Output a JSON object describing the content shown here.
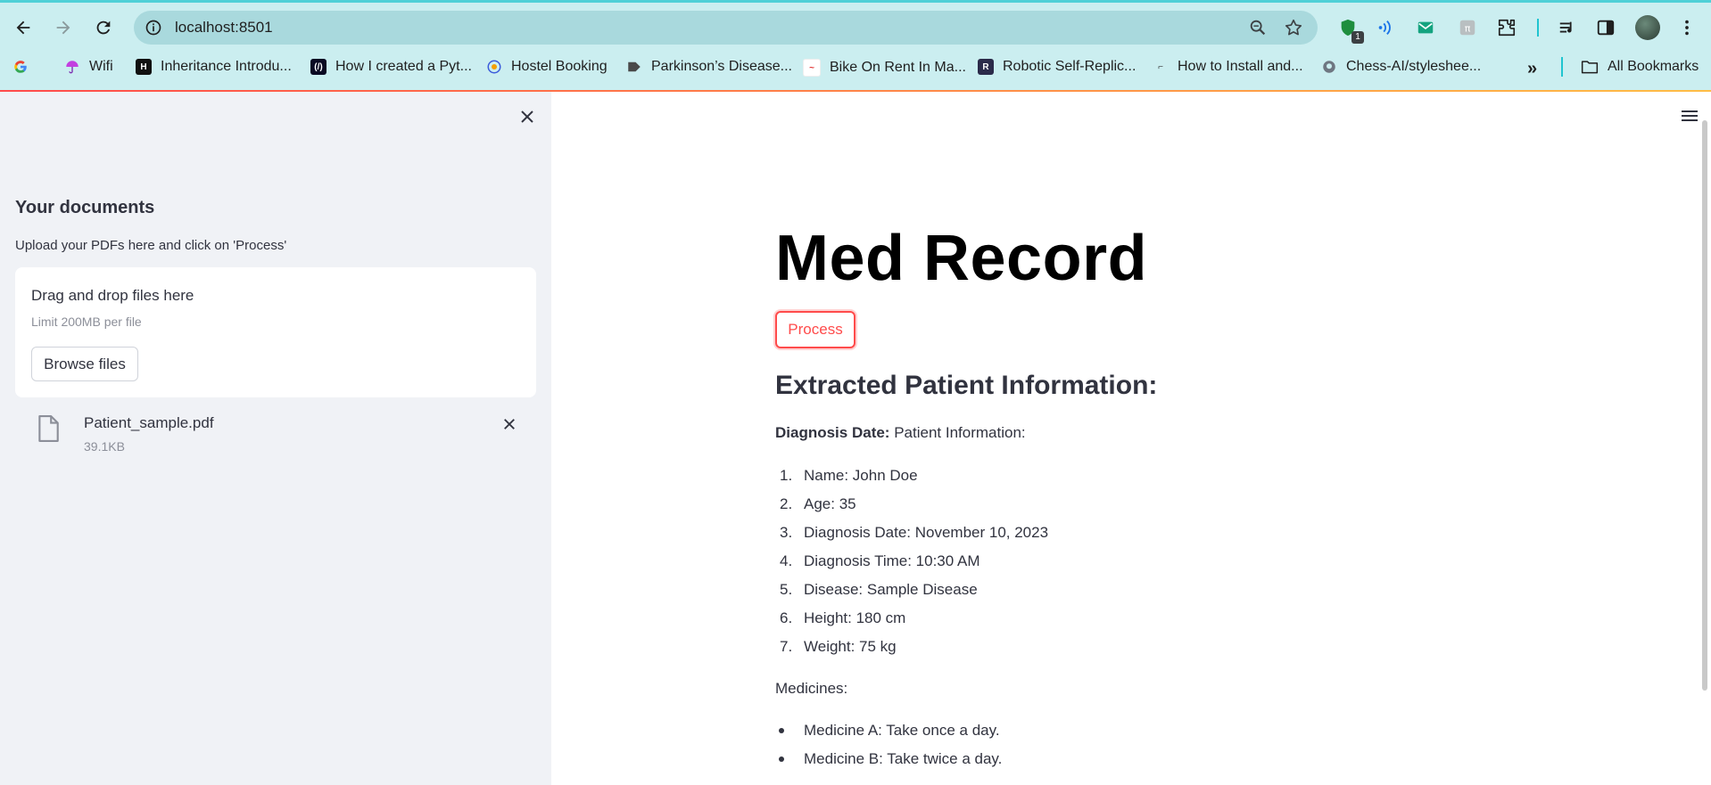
{
  "browser": {
    "url": "localhost:8501",
    "extension_badge": "1",
    "bookmarks": [
      {
        "label": "Wifi",
        "icon": "umbrella-icon"
      },
      {
        "label": "Inheritance Introdu...",
        "icon": "hashnode-icon"
      },
      {
        "label": "How I created a Pyt...",
        "icon": "freecodecamp-icon"
      },
      {
        "label": "Hostel Booking",
        "icon": "hostel-icon"
      },
      {
        "label": "Parkinson’s Disease...",
        "icon": "tag-icon"
      },
      {
        "label": "Bike On Rent In Ma...",
        "icon": "bike-rent-icon"
      },
      {
        "label": "Robotic Self-Replic...",
        "icon": "r-logo-icon"
      },
      {
        "label": "How to Install and...",
        "icon": "tool-icon"
      },
      {
        "label": "Chess-AI/styleshee...",
        "icon": "github-icon"
      }
    ],
    "all_bookmarks": "All Bookmarks"
  },
  "sidebar": {
    "title": "Your documents",
    "caption": "Upload your PDFs here and click on 'Process'",
    "dropzone": {
      "title": "Drag and drop files here",
      "limit": "Limit 200MB per file",
      "browse_label": "Browse files"
    },
    "file": {
      "name": "Patient_sample.pdf",
      "size": "39.1KB"
    }
  },
  "main": {
    "title": "Med Record",
    "process_label": "Process",
    "subheading": "Extracted Patient Information:",
    "diagnosis_label": "Diagnosis Date:",
    "diagnosis_value": "Patient Information:",
    "info_items": [
      {
        "num": "1.",
        "text": "Name: John Doe"
      },
      {
        "num": "2.",
        "text": "Age: 35"
      },
      {
        "num": "3.",
        "text": "Diagnosis Date: November 10, 2023"
      },
      {
        "num": "4.",
        "text": "Diagnosis Time: 10:30 AM"
      },
      {
        "num": "5.",
        "text": "Disease: Sample Disease"
      },
      {
        "num": "6.",
        "text": "Height: 180 cm"
      },
      {
        "num": "7.",
        "text": "Weight: 75 kg"
      }
    ],
    "medicines_label": "Medicines:",
    "medicines": [
      "Medicine A: Take once a day.",
      "Medicine B: Take twice a day."
    ]
  },
  "colors": {
    "accent": "#ff4b4b",
    "sidebar_bg": "#f0f2f6",
    "chrome_bg": "#cbeef0",
    "text": "#31333f"
  }
}
